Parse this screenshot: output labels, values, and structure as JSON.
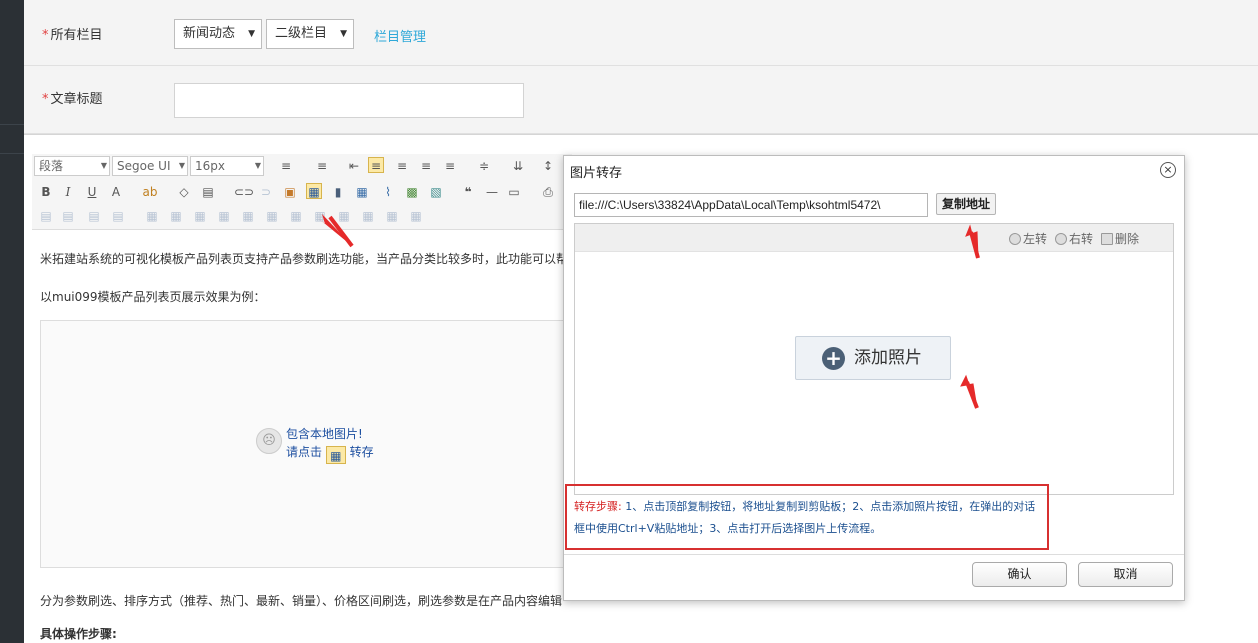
{
  "form": {
    "category_label": "所有栏目",
    "category_select_1": "新闻动态",
    "category_select_2": "二级栏目",
    "category_manage_link": "栏目管理",
    "title_label": "文章标题",
    "title_value": "",
    "required_mark": "*"
  },
  "toolbar": {
    "paragraph_select": "段落",
    "font_select": "Segoe UI",
    "size_select": "16px"
  },
  "editor_content": {
    "line1": "米拓建站系统的可视化模板产品列表页支持产品参数刷选功能，当产品分类比较多时，此功能可以帮",
    "line2": "以mui099模板产品列表页展示效果为例：",
    "placeholder_line1": "包含本地图片!",
    "placeholder_line2_pre": "请点击",
    "placeholder_line2_post": "转存",
    "line3": "分为参数刷选、排序方式（推荐、热门、最新、销量）、价格区间刷选，刷选参数是在产品内容编辑",
    "line4": "具体操作步骤:"
  },
  "dialog": {
    "title": "图片转存",
    "close_symbol": "×",
    "file_url": "file:///C:\\Users\\33824\\AppData\\Local\\Temp\\ksohtml5472\\",
    "copy_button": "复制地址",
    "rotate_left": "左转",
    "rotate_right": "右转",
    "delete": "删除",
    "add_photo_button": "添加照片",
    "steps_prefix": "转存步骤:",
    "steps_text": " 1、点击顶部复制按钮，将地址复制到剪贴板；2、点击添加照片按钮，在弹出的对话框中使用Ctrl+V粘贴地址；3、点击打开后选择图片上传流程。",
    "confirm_button": "确认",
    "cancel_button": "取消"
  },
  "colors": {
    "link": "#2ea8d8",
    "required": "#e04040",
    "highlight_box": "#d73030",
    "steps_text": "#1b4f8f"
  }
}
